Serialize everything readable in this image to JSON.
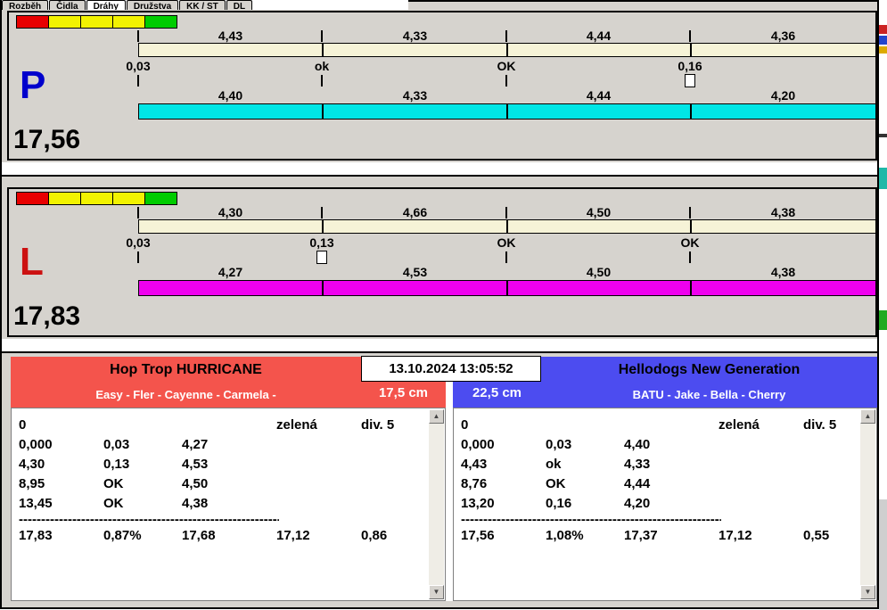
{
  "tabs": [
    {
      "label": "Rozběh",
      "selected": false
    },
    {
      "label": "Čidla",
      "selected": false
    },
    {
      "label": "Dráhy",
      "selected": true
    },
    {
      "label": "Družstva",
      "selected": false
    },
    {
      "label": "KK / ST",
      "selected": false
    },
    {
      "label": "DL",
      "selected": false
    }
  ],
  "colors": {
    "traffic": [
      "#e80000",
      "#f2f200",
      "#f2f200",
      "#f2f200",
      "#00cc00"
    ],
    "upper_bar": "#f6f3d7",
    "lane_p_bar": "#00e6e6",
    "lane_l_bar": "#ee00ee",
    "lane_p_letter": "#0000cc",
    "lane_l_letter": "#cc1111",
    "team_left_header": "#f4544c",
    "team_right_header": "#4c4cf0"
  },
  "lanes": [
    {
      "letter": "P",
      "total": "17,56",
      "top_values": [
        "4,43",
        "4,33",
        "4,44",
        "4,36"
      ],
      "mid_labels": [
        "0,03",
        "ok",
        "OK",
        "0,16"
      ],
      "bottom_values": [
        "4,40",
        "4,33",
        "4,44",
        "4,20"
      ]
    },
    {
      "letter": "L",
      "total": "17,83",
      "top_values": [
        "4,30",
        "4,66",
        "4,50",
        "4,38"
      ],
      "mid_labels": [
        "0,03",
        "0,13",
        "OK",
        "OK"
      ],
      "bottom_values": [
        "4,27",
        "4,53",
        "4,50",
        "4,38"
      ]
    }
  ],
  "results": {
    "timestamp": "13.10.2024 13:05:52",
    "left": {
      "team": "Hop Trop HURRICANE",
      "dogs": "Easy - Fler - Cayenne - Carmela -",
      "height": "17,5 cm",
      "rows": [
        [
          "0",
          "",
          "",
          "zelená",
          "div. 5"
        ],
        [
          "0,000",
          "0,03",
          "4,27",
          "",
          ""
        ],
        [
          "4,30",
          "0,13",
          "4,53",
          "",
          ""
        ],
        [
          "8,95",
          "OK",
          "4,50",
          "",
          ""
        ],
        [
          "13,45",
          "OK",
          "4,38",
          "",
          ""
        ]
      ],
      "separator": "------------------------------------------------------------",
      "totals": [
        "17,83",
        "0,87%",
        "17,68",
        "17,12",
        "0,86"
      ]
    },
    "right": {
      "team": "Hellodogs New Generation",
      "dogs": "BATU - Jake - Bella - Cherry",
      "height": "22,5 cm",
      "rows": [
        [
          "0",
          "",
          "",
          "zelená",
          "div. 5"
        ],
        [
          "0,000",
          "0,03",
          "4,40",
          "",
          ""
        ],
        [
          "4,43",
          "ok",
          "4,33",
          "",
          ""
        ],
        [
          "8,76",
          "OK",
          "4,44",
          "",
          ""
        ],
        [
          "13,20",
          "0,16",
          "4,20",
          "",
          ""
        ]
      ],
      "separator": "------------------------------------------------------------",
      "totals": [
        "17,56",
        "1,08%",
        "17,37",
        "17,12",
        "0,55"
      ]
    }
  },
  "icons": {
    "scroll_up": "▲",
    "scroll_down": "▼"
  }
}
